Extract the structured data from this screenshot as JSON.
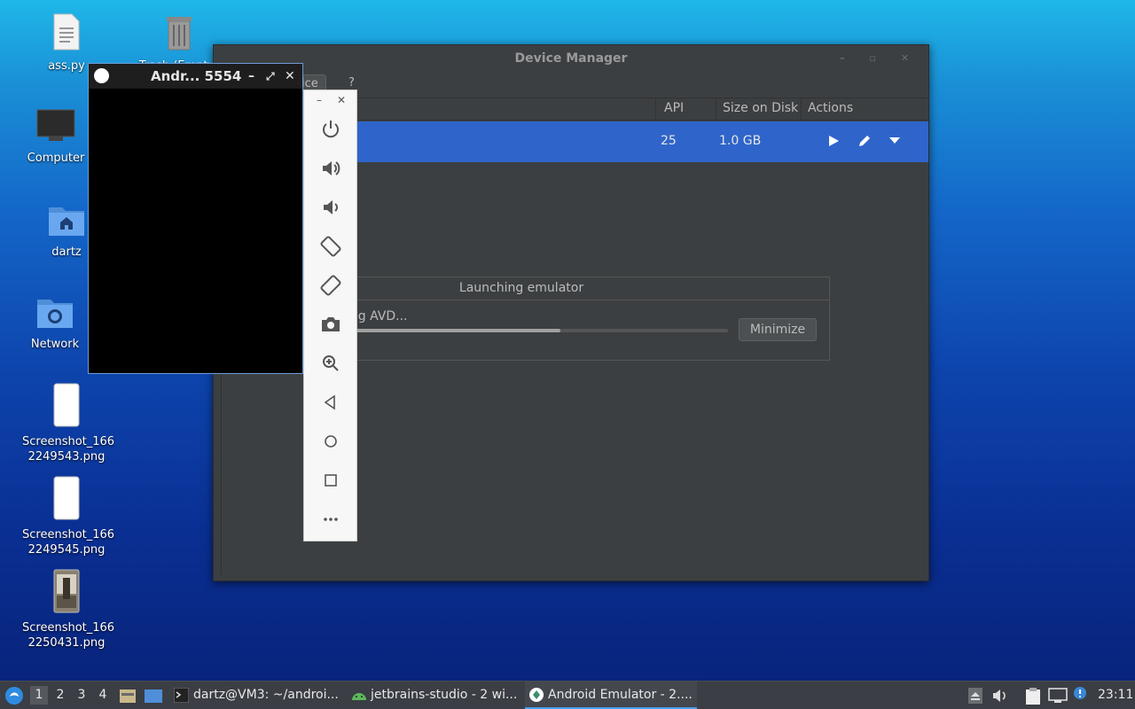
{
  "desktop": {
    "icons": [
      {
        "label": "ass.py",
        "icon": "text-file-icon"
      },
      {
        "label": "Trash (Empty)",
        "icon": "trash-icon"
      },
      {
        "label": "Computer",
        "icon": "computer-icon"
      },
      {
        "label": "dartz",
        "icon": "home-folder-icon"
      },
      {
        "label": "Network",
        "icon": "network-folder-icon"
      },
      {
        "label": "Screenshot_1662249543.png",
        "line1": "Screenshot_166",
        "line2": "2249543.png",
        "icon": "image-file-icon"
      },
      {
        "label": "Screenshot_1662249545.png",
        "line1": "Screenshot_166",
        "line2": "2249545.png",
        "icon": "image-file-icon"
      },
      {
        "label": "Screenshot_1662250431.png",
        "line1": "Screenshot_166",
        "line2": "2250431.png",
        "icon": "image-file-icon"
      }
    ]
  },
  "device_manager": {
    "title": "Device Manager",
    "toolbar": {
      "create_label": "ice",
      "help_label": "?"
    },
    "columns": {
      "api": "API",
      "size": "Size on Disk",
      "actions": "Actions"
    },
    "rows": [
      {
        "api": "25",
        "size": "1.0 GB",
        "actions": [
          "play-icon",
          "edit-icon",
          "dropdown-icon"
        ]
      }
    ]
  },
  "launch_dialog": {
    "title": "Launching emulator",
    "status": "ing AVD...",
    "progress": 0.56,
    "minimize_label": "Minimize"
  },
  "emulator": {
    "title": "Andr... 5554",
    "side_toolbar": [
      "power-icon",
      "volume-up-icon",
      "volume-down-icon",
      "rotate-left-icon",
      "rotate-right-icon",
      "camera-icon",
      "zoom-icon",
      "back-icon",
      "home-icon",
      "overview-icon",
      "more-icon"
    ]
  },
  "taskbar": {
    "workspaces": [
      "1",
      "2",
      "3",
      "4"
    ],
    "tasks": [
      {
        "label": "dartz@VM3: ~/androi...",
        "icon": "terminal-icon",
        "active": false
      },
      {
        "label": "jetbrains-studio - 2 wi...",
        "icon": "android-icon",
        "active": false
      },
      {
        "label": "Android Emulator - 2....",
        "icon": "emulator-icon",
        "active": true
      }
    ],
    "clock": "23:11"
  },
  "colors": {
    "accent": "#2f65ca",
    "window_bg": "#3c3f41",
    "taskbar": "#3b3e44"
  }
}
